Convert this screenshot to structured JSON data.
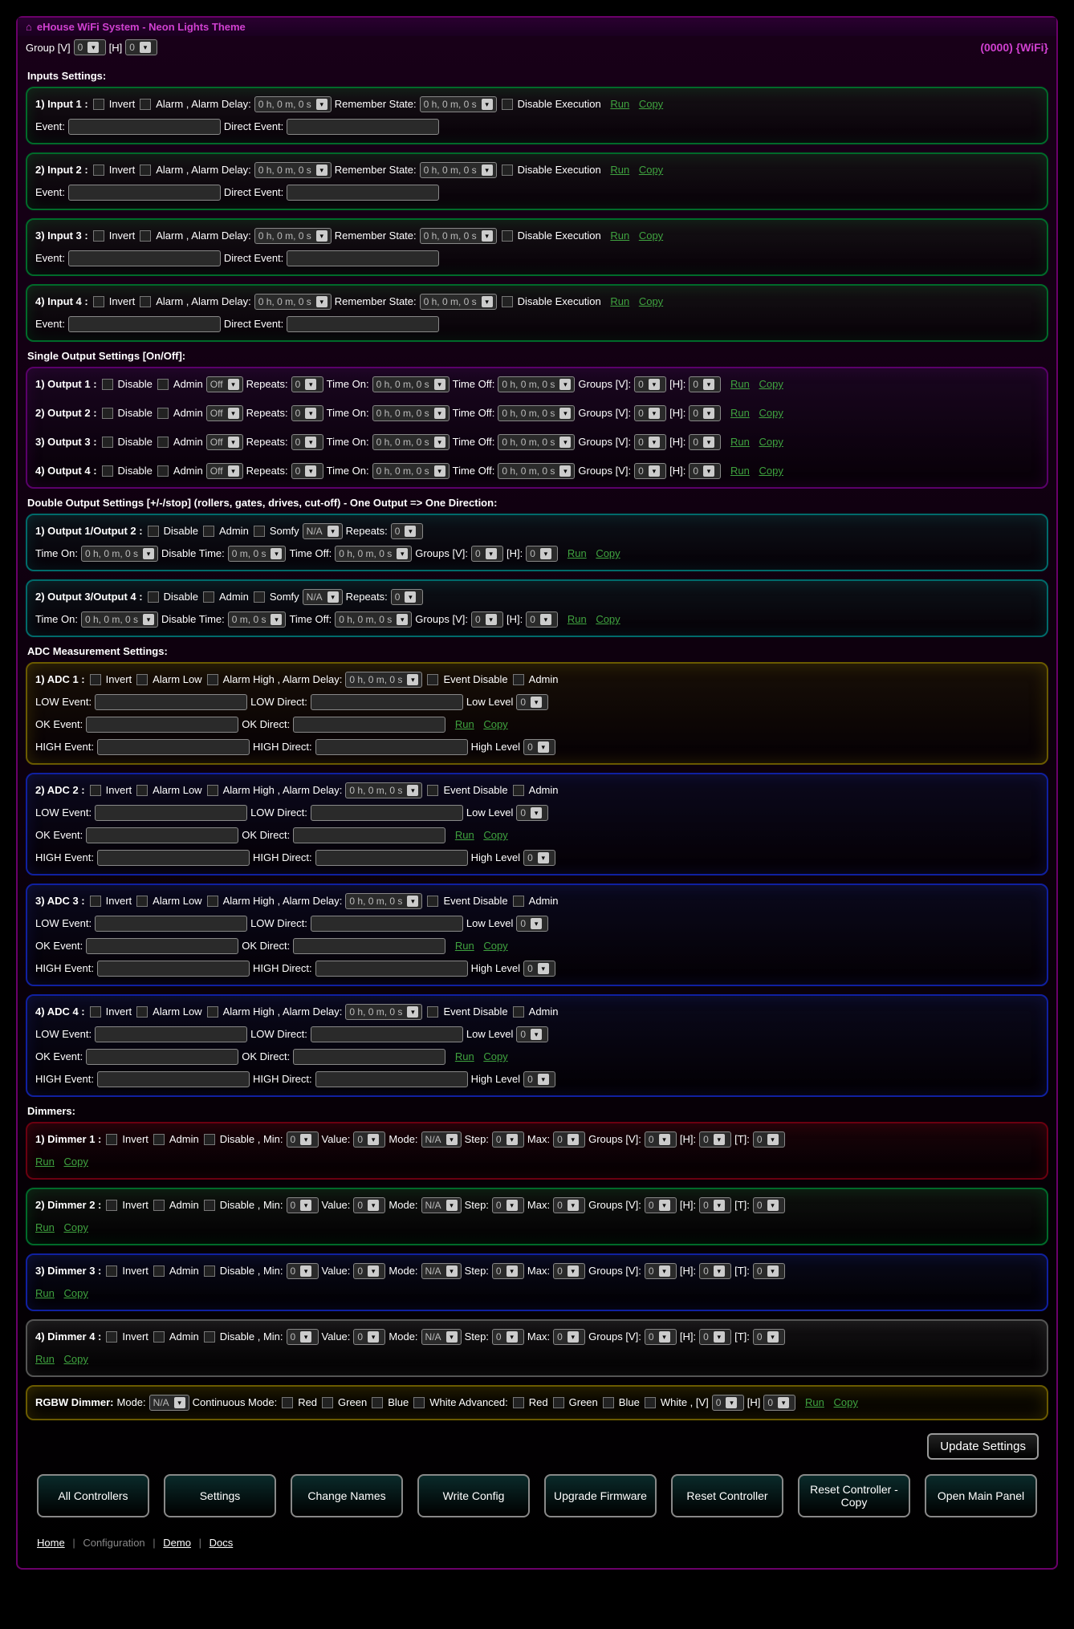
{
  "header": {
    "title": "eHouse WiFi System - Neon Lights Theme",
    "id_label": "(0000) {WiFi}"
  },
  "group_bar": {
    "group_label": "Group [V]",
    "group_v": "0",
    "h_label": "[H]",
    "group_h": "0"
  },
  "inputs_section": {
    "title": "Inputs Settings:",
    "rows": [
      {
        "label": "1) Input 1 :",
        "invert": "Invert",
        "alarm": "Alarm , Alarm Delay:",
        "delay": "0 h, 0 m, 0 s",
        "remember": "Remember State:",
        "state": "0 h, 0 m, 0 s",
        "disable": "Disable Execution",
        "event": "Event:",
        "direct": "Direct Event:"
      },
      {
        "label": "2) Input 2 :",
        "invert": "Invert",
        "alarm": "Alarm , Alarm Delay:",
        "delay": "0 h, 0 m, 0 s",
        "remember": "Remember State:",
        "state": "0 h, 0 m, 0 s",
        "disable": "Disable Execution",
        "event": "Event:",
        "direct": "Direct Event:"
      },
      {
        "label": "3) Input 3 :",
        "invert": "Invert",
        "alarm": "Alarm , Alarm Delay:",
        "delay": "0 h, 0 m, 0 s",
        "remember": "Remember State:",
        "state": "0 h, 0 m, 0 s",
        "disable": "Disable Execution",
        "event": "Event:",
        "direct": "Direct Event:"
      },
      {
        "label": "4) Input 4 :",
        "invert": "Invert",
        "alarm": "Alarm , Alarm Delay:",
        "delay": "0 h, 0 m, 0 s",
        "remember": "Remember State:",
        "state": "0 h, 0 m, 0 s",
        "disable": "Disable Execution",
        "event": "Event:",
        "direct": "Direct Event:"
      }
    ]
  },
  "single_output": {
    "title": "Single Output Settings [On/Off]:",
    "rows": [
      {
        "label": "1) Output 1 :"
      },
      {
        "label": "2) Output 2 :"
      },
      {
        "label": "3) Output 3 :"
      },
      {
        "label": "4) Output 4 :"
      }
    ],
    "fields": {
      "disable": "Disable",
      "admin": "Admin",
      "off": "Off",
      "repeats": "Repeats:",
      "r": "0",
      "timeon": "Time On:",
      "ton": "0 h, 0 m, 0 s",
      "timeoff": "Time Off:",
      "toff": "0 h, 0 m, 0 s",
      "gv": "Groups [V]:",
      "gv_v": "0",
      "h": "[H]:",
      "h_v": "0"
    }
  },
  "double_output": {
    "title": "Double Output Settings [+/-/stop] (rollers, gates, drives, cut-off) - One Output => One Direction:",
    "rows": [
      {
        "label": "1) Output 1/Output 2 :"
      },
      {
        "label": "2) Output 3/Output 4 :"
      }
    ],
    "fields": {
      "disable": "Disable",
      "admin": "Admin",
      "somfy": "Somfy",
      "na": "N/A",
      "repeats": "Repeats:",
      "r": "0",
      "timeon": "Time On:",
      "ton": "0 h, 0 m, 0 s",
      "disabletime": "Disable Time:",
      "dt": "0 m, 0 s",
      "timeoff": "Time Off:",
      "toff": "0 h, 0 m, 0 s",
      "gv": "Groups [V]:",
      "gv_v": "0",
      "h": "[H]:",
      "h_v": "0"
    }
  },
  "adc": {
    "title": "ADC Measurement Settings:",
    "rows": [
      {
        "label": "1) ADC 1 :"
      },
      {
        "label": "2) ADC 2 :"
      },
      {
        "label": "3) ADC 3 :"
      },
      {
        "label": "4) ADC 4 :"
      }
    ],
    "fields": {
      "invert": "Invert",
      "alow": "Alarm Low",
      "ahigh": "Alarm High , Alarm Delay:",
      "delay": "0 h, 0 m, 0 s",
      "evdisable": "Event Disable",
      "admin": "Admin",
      "lowev": "LOW Event:",
      "lowdir": "LOW Direct:",
      "lowlvl": "Low Level",
      "lowlvl_v": "0",
      "okev": "OK Event:",
      "okdir": "OK Direct:",
      "highev": "HIGH Event:",
      "highdir": "HIGH Direct:",
      "highlvl": "High Level",
      "highlvl_v": "0"
    }
  },
  "dimmers": {
    "title": "Dimmers:",
    "rows": [
      {
        "label": "1) Dimmer 1 :"
      },
      {
        "label": "2) Dimmer 2 :"
      },
      {
        "label": "3) Dimmer 3 :"
      },
      {
        "label": "4) Dimmer 4 :"
      }
    ],
    "fields": {
      "invert": "Invert",
      "admin": "Admin",
      "disable": "Disable , Min:",
      "min": "0",
      "value": "Value:",
      "val": "0",
      "mode": "Mode:",
      "na": "N/A",
      "step": "Step:",
      "st": "0",
      "max": "Max:",
      "mx": "0",
      "gv": "Groups [V]:",
      "gvv": "0",
      "h": "[H]:",
      "hv": "0",
      "t": "[T]:",
      "tv": "0"
    },
    "rgbw": {
      "label": "RGBW Dimmer:",
      "mode": "Mode:",
      "na": "N/A",
      "cont": "Continuous Mode:",
      "red": "Red",
      "green": "Green",
      "blue": "Blue",
      "wadv": "White Advanced:",
      "white": "White , [V]",
      "v": "0",
      "h": "[H]",
      "hv": "0"
    }
  },
  "run": "Run",
  "copy": "Copy",
  "update_btn": "Update Settings",
  "btns": [
    "All Controllers",
    "Settings",
    "Change Names",
    "Write Config",
    "Upgrade Firmware",
    "Reset Controller",
    "Reset Controller - Copy",
    "Open Main Panel"
  ],
  "footer": {
    "home": "Home",
    "config": "Configuration",
    "demo": "Demo",
    "docs": "Docs"
  }
}
